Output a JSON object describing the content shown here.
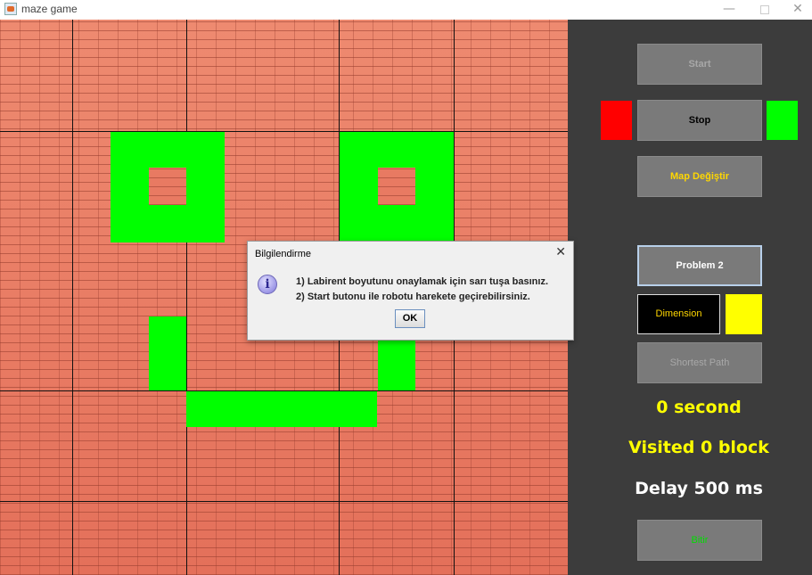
{
  "window": {
    "title": "maze game",
    "minimize_glyph": "—",
    "close_glyph": "✕"
  },
  "panel": {
    "start_label": "Start",
    "stop_label": "Stop",
    "map_label": "Map Değiştir",
    "problem_label": "Problem 2",
    "dimension_label": "Dimension",
    "shortest_label": "Shortest Path",
    "time_text": "0 second",
    "visited_text": "Visited 0 block",
    "delay_text": "Delay 500 ms",
    "finish_label": "Bitir"
  },
  "colors": {
    "wall": "#e87a62",
    "path": "#00ff00",
    "status_red": "#ff0000",
    "status_green": "#00ff00",
    "dimension_yellow": "#ffff00",
    "text_yellow": "#ffff00",
    "text_white": "#ffffff"
  },
  "dialog": {
    "title": "Bilgilendirme",
    "close_glyph": "✕",
    "icon": "info-icon",
    "line1": "1) Labirent boyutunu onaylamak için sarı tuşa basınız.",
    "line2": "2) Start butonu ile robotu harekete geçirebilirsiniz.",
    "ok_label": "OK"
  }
}
